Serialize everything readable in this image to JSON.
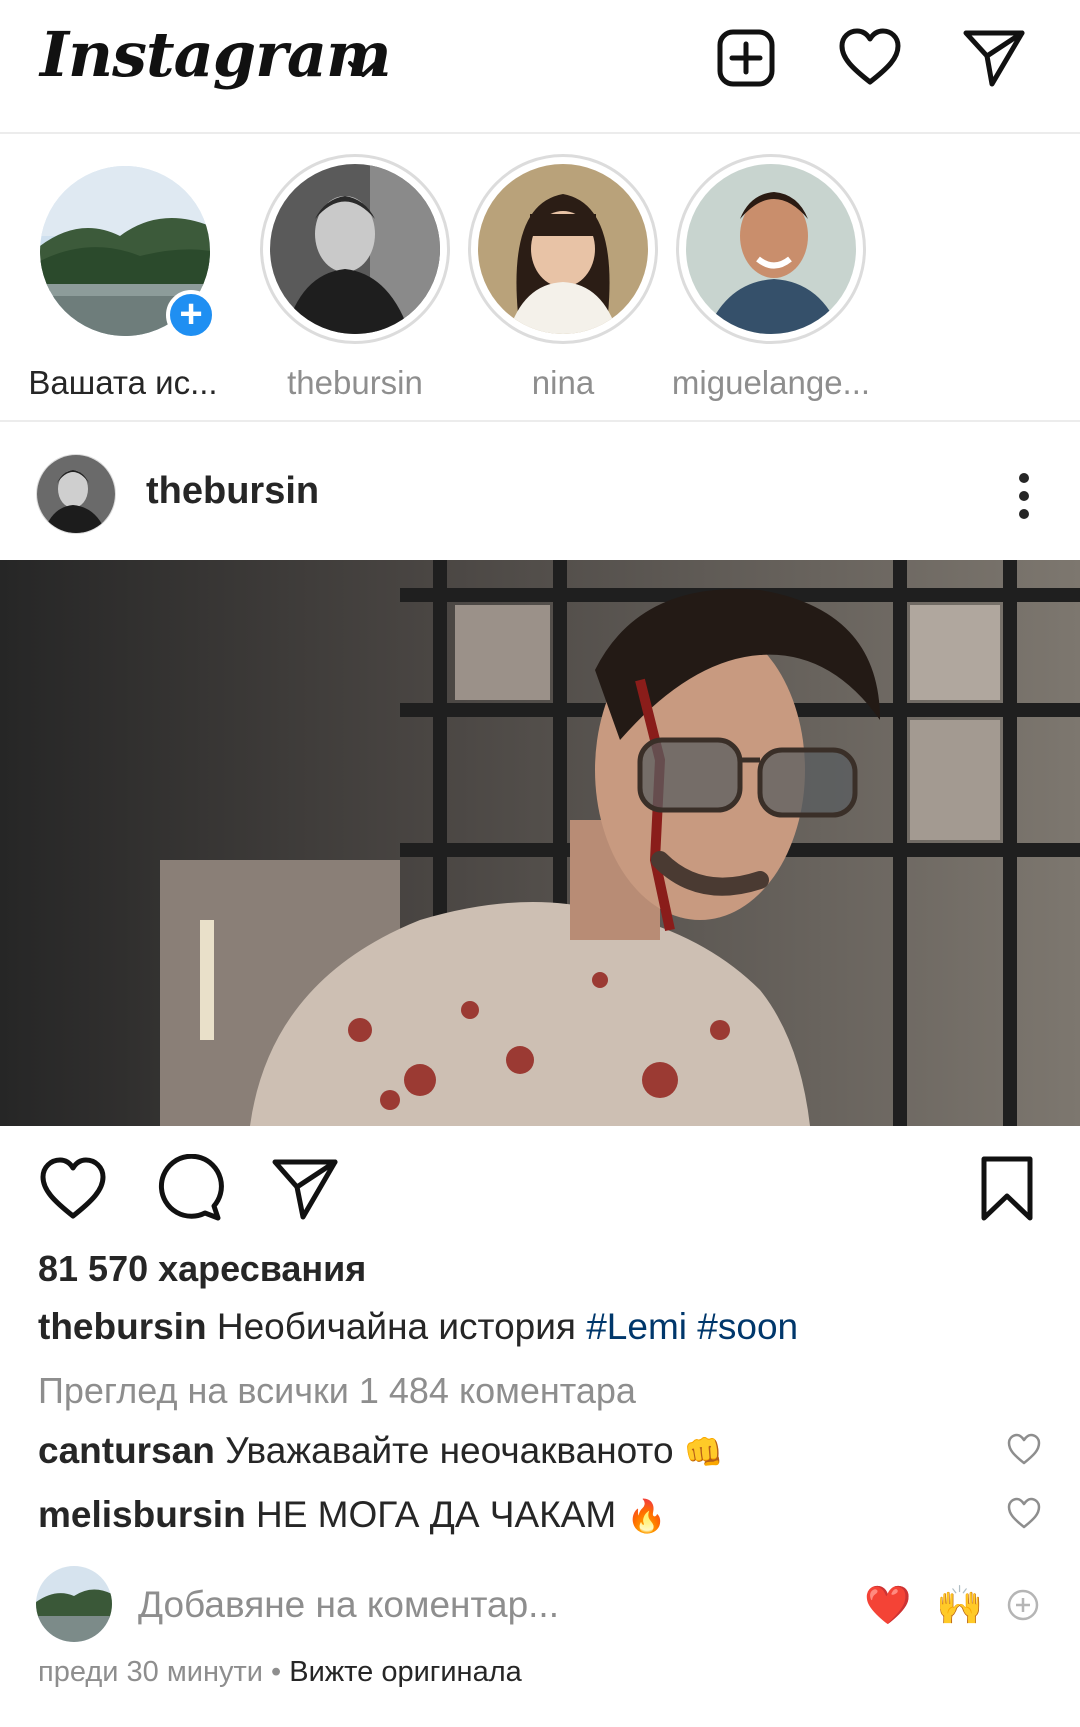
{
  "header": {
    "logo": "Instagram",
    "icons": [
      "new-post-icon",
      "activity-heart-icon",
      "direct-message-icon"
    ]
  },
  "stories": [
    {
      "label": "Вашата ис...",
      "own": true
    },
    {
      "label": "thebursin"
    },
    {
      "label": "nina"
    },
    {
      "label": "miguelange..."
    }
  ],
  "post": {
    "username": "thebursin",
    "likes": "81 570 харесвания",
    "caption_user": "thebursin",
    "caption_text": "Необичайна история",
    "hashtags": [
      "#Lemi",
      "#soon"
    ],
    "view_all": "Преглед на всички 1 484 коментара",
    "comments": [
      {
        "user": "cantursan",
        "text": "Уважавайте неочакваното",
        "emoji": "👊"
      },
      {
        "user": "melisbursin",
        "text": "НЕ МОГА ДА ЧАКАМ",
        "emoji": "🔥"
      }
    ],
    "add_comment_placeholder": "Добавяне на коментар...",
    "quick_reactions": [
      "❤️",
      "🙌"
    ],
    "time": "преди 30 минути",
    "separator": "•",
    "see_original": "Вижте оригинала"
  },
  "colors": {
    "accent_blue": "#1f8ff2",
    "hashtag": "#00376b",
    "secondary_text": "#8e8e8e",
    "reaction_heart": "#ed1c3b"
  }
}
